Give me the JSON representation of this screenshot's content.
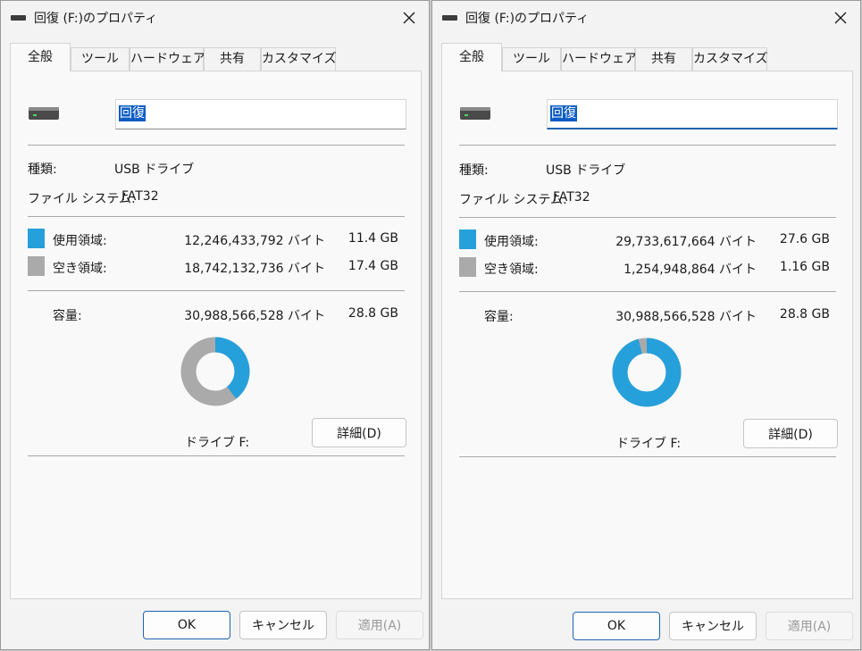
{
  "colors": {
    "used": "#26a0da",
    "free": "#aaaaaa"
  },
  "dialogs": [
    {
      "title": "回復 (F:)のプロパティ",
      "tabs": [
        "全般",
        "ツール",
        "ハードウェア",
        "共有",
        "カスタマイズ"
      ],
      "name_value": "回復",
      "type_label": "種類:",
      "type_value": "USB ドライブ",
      "fs_label": "ファイル システム:",
      "fs_value": "FAT32",
      "used_label": "使用領域:",
      "used_bytes": "12,246,433,792 バイト",
      "used_size": "11.4 GB",
      "free_label": "空き領域:",
      "free_bytes": "18,742,132,736 バイト",
      "free_size": "17.4 GB",
      "cap_label": "容量:",
      "cap_bytes": "30,988,566,528 バイト",
      "cap_size": "28.8 GB",
      "used_fraction": 0.3952,
      "drive_label": "ドライブ F:",
      "details_button": "詳細(D)",
      "ok_button": "OK",
      "cancel_button": "キャンセル",
      "apply_button": "適用(A)"
    },
    {
      "title": "回復 (F:)のプロパティ",
      "tabs": [
        "全般",
        "ツール",
        "ハードウェア",
        "共有",
        "カスタマイズ"
      ],
      "name_value": "回復",
      "type_label": "種類:",
      "type_value": "USB ドライブ",
      "fs_label": "ファイル システム:",
      "fs_value": "FAT32",
      "used_label": "使用領域:",
      "used_bytes": "29,733,617,664 バイト",
      "used_size": "27.6 GB",
      "free_label": "空き領域:",
      "free_bytes": "1,254,948,864 バイト",
      "free_size": "1.16 GB",
      "cap_label": "容量:",
      "cap_bytes": "30,988,566,528 バイト",
      "cap_size": "28.8 GB",
      "used_fraction": 0.9595,
      "drive_label": "ドライブ F:",
      "details_button": "詳細(D)",
      "ok_button": "OK",
      "cancel_button": "キャンセル",
      "apply_button": "適用(A)"
    }
  ]
}
